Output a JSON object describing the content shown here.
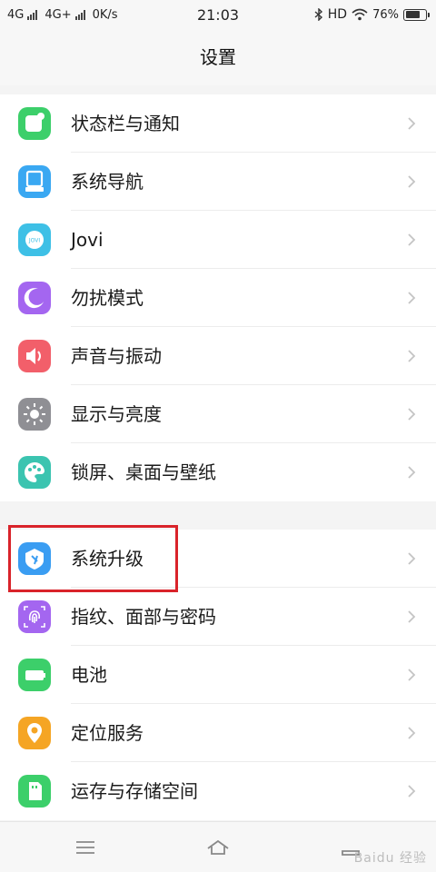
{
  "status_bar": {
    "net1": "4G",
    "net2": "4G+",
    "speed": "0K/s",
    "time": "21:03",
    "hd": "HD",
    "battery_pct": "76%",
    "battery_level": 0.76
  },
  "header": {
    "title": "设置"
  },
  "group1": [
    {
      "label": "状态栏与通知",
      "icon": "statusbar-notification-icon",
      "color": "#3ccf6a"
    },
    {
      "label": "系统导航",
      "icon": "navigation-icon",
      "color": "#3aa8f2"
    },
    {
      "label": "Jovi",
      "icon": "jovi-icon",
      "color": "#3ec0e6"
    },
    {
      "label": "勿扰模式",
      "icon": "moon-icon",
      "color": "#a466f0"
    },
    {
      "label": "声音与振动",
      "icon": "speaker-icon",
      "color": "#f25f6a"
    },
    {
      "label": "显示与亮度",
      "icon": "sun-icon",
      "color": "#8f8f94"
    },
    {
      "label": "锁屏、桌面与壁纸",
      "icon": "palette-icon",
      "color": "#3bc4b0"
    }
  ],
  "group2": [
    {
      "label": "系统升级",
      "icon": "system-update-icon",
      "color": "#3a9df2"
    },
    {
      "label": "指纹、面部与密码",
      "icon": "fingerprint-icon",
      "color": "#a466f0"
    },
    {
      "label": "电池",
      "icon": "battery-icon",
      "color": "#3ccf6a"
    },
    {
      "label": "定位服务",
      "icon": "location-icon",
      "color": "#f5a524"
    },
    {
      "label": "运存与存储空间",
      "icon": "storage-icon",
      "color": "#3ccf6a"
    }
  ],
  "watermark": {
    "text": "Baidu 经验"
  }
}
